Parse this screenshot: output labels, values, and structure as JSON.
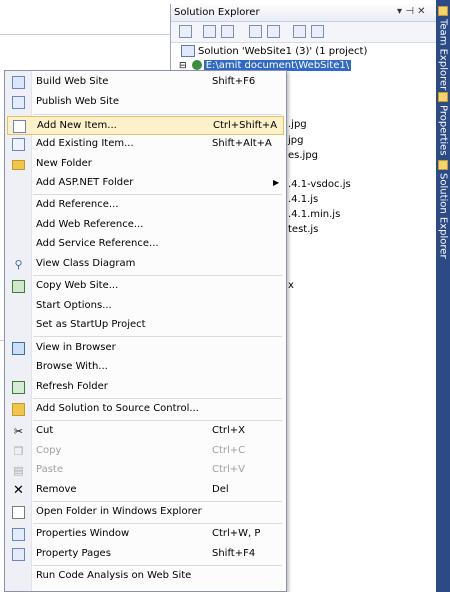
{
  "solution_explorer": {
    "title": "Solution Explorer",
    "pin_glyph": "▾ ⊣ ✕",
    "solution_label": "Solution 'WebSite1 (3)' (1 project)",
    "project_label": "E:\\amit document\\WebSite1\\",
    "partial_items": [
      ".jpg",
      "jpg",
      "es.jpg",
      ".4.1-vsdoc.js",
      ".4.1.js",
      ".4.1.min.js",
      "test.js",
      "x"
    ]
  },
  "right_tabs": [
    "Team Explorer",
    "Properties",
    "Solution Explorer"
  ],
  "menu": {
    "items": [
      {
        "label": "Build Web Site",
        "shortcut": "Shift+F6",
        "icon": "build-icon"
      },
      {
        "label": "Publish Web Site",
        "shortcut": "",
        "icon": "publish-icon"
      },
      {
        "label": "Add New Item...",
        "shortcut": "Ctrl+Shift+A",
        "icon": "new-item-icon"
      },
      {
        "label": "Add Existing Item...",
        "shortcut": "Shift+Alt+A",
        "icon": "existing-item-icon"
      },
      {
        "label": "New Folder",
        "shortcut": "",
        "icon": "folder-icon"
      },
      {
        "label": "Add ASP.NET Folder",
        "shortcut": "",
        "icon": ""
      },
      {
        "label": "Add Reference...",
        "shortcut": "",
        "icon": ""
      },
      {
        "label": "Add Web Reference...",
        "shortcut": "",
        "icon": ""
      },
      {
        "label": "Add Service Reference...",
        "shortcut": "",
        "icon": ""
      },
      {
        "label": "View Class Diagram",
        "shortcut": "",
        "icon": "class-diagram-icon"
      },
      {
        "label": "Copy Web Site...",
        "shortcut": "",
        "icon": "copy-site-icon"
      },
      {
        "label": "Start Options...",
        "shortcut": "",
        "icon": ""
      },
      {
        "label": "Set as StartUp Project",
        "shortcut": "",
        "icon": ""
      },
      {
        "label": "View in Browser",
        "shortcut": "",
        "icon": "browser-icon"
      },
      {
        "label": "Browse With...",
        "shortcut": "",
        "icon": ""
      },
      {
        "label": "Refresh Folder",
        "shortcut": "",
        "icon": "refresh-icon"
      },
      {
        "label": "Add Solution to Source Control...",
        "shortcut": "",
        "icon": "source-control-icon"
      },
      {
        "label": "Cut",
        "shortcut": "Ctrl+X",
        "icon": "cut-icon"
      },
      {
        "label": "Copy",
        "shortcut": "Ctrl+C",
        "icon": "copy-icon"
      },
      {
        "label": "Paste",
        "shortcut": "Ctrl+V",
        "icon": "paste-icon"
      },
      {
        "label": "Remove",
        "shortcut": "Del",
        "icon": "remove-icon"
      },
      {
        "label": "Open Folder in Windows Explorer",
        "shortcut": "",
        "icon": "open-folder-icon"
      },
      {
        "label": "Properties Window",
        "shortcut": "Ctrl+W, P",
        "icon": "properties-window-icon"
      },
      {
        "label": "Property Pages",
        "shortcut": "Shift+F4",
        "icon": "property-pages-icon"
      },
      {
        "label": "Run Code Analysis on Web Site",
        "shortcut": "",
        "icon": ""
      }
    ]
  }
}
